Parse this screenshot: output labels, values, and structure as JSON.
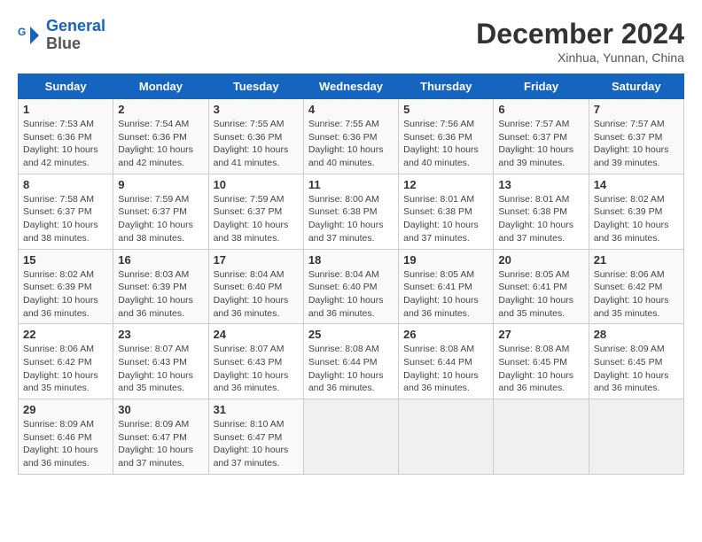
{
  "header": {
    "logo_line1": "General",
    "logo_line2": "Blue",
    "month": "December 2024",
    "location": "Xinhua, Yunnan, China"
  },
  "days_of_week": [
    "Sunday",
    "Monday",
    "Tuesday",
    "Wednesday",
    "Thursday",
    "Friday",
    "Saturday"
  ],
  "weeks": [
    [
      {
        "day": "1",
        "detail": "Sunrise: 7:53 AM\nSunset: 6:36 PM\nDaylight: 10 hours\nand 42 minutes."
      },
      {
        "day": "2",
        "detail": "Sunrise: 7:54 AM\nSunset: 6:36 PM\nDaylight: 10 hours\nand 42 minutes."
      },
      {
        "day": "3",
        "detail": "Sunrise: 7:55 AM\nSunset: 6:36 PM\nDaylight: 10 hours\nand 41 minutes."
      },
      {
        "day": "4",
        "detail": "Sunrise: 7:55 AM\nSunset: 6:36 PM\nDaylight: 10 hours\nand 40 minutes."
      },
      {
        "day": "5",
        "detail": "Sunrise: 7:56 AM\nSunset: 6:36 PM\nDaylight: 10 hours\nand 40 minutes."
      },
      {
        "day": "6",
        "detail": "Sunrise: 7:57 AM\nSunset: 6:37 PM\nDaylight: 10 hours\nand 39 minutes."
      },
      {
        "day": "7",
        "detail": "Sunrise: 7:57 AM\nSunset: 6:37 PM\nDaylight: 10 hours\nand 39 minutes."
      }
    ],
    [
      {
        "day": "8",
        "detail": "Sunrise: 7:58 AM\nSunset: 6:37 PM\nDaylight: 10 hours\nand 38 minutes."
      },
      {
        "day": "9",
        "detail": "Sunrise: 7:59 AM\nSunset: 6:37 PM\nDaylight: 10 hours\nand 38 minutes."
      },
      {
        "day": "10",
        "detail": "Sunrise: 7:59 AM\nSunset: 6:37 PM\nDaylight: 10 hours\nand 38 minutes."
      },
      {
        "day": "11",
        "detail": "Sunrise: 8:00 AM\nSunset: 6:38 PM\nDaylight: 10 hours\nand 37 minutes."
      },
      {
        "day": "12",
        "detail": "Sunrise: 8:01 AM\nSunset: 6:38 PM\nDaylight: 10 hours\nand 37 minutes."
      },
      {
        "day": "13",
        "detail": "Sunrise: 8:01 AM\nSunset: 6:38 PM\nDaylight: 10 hours\nand 37 minutes."
      },
      {
        "day": "14",
        "detail": "Sunrise: 8:02 AM\nSunset: 6:39 PM\nDaylight: 10 hours\nand 36 minutes."
      }
    ],
    [
      {
        "day": "15",
        "detail": "Sunrise: 8:02 AM\nSunset: 6:39 PM\nDaylight: 10 hours\nand 36 minutes."
      },
      {
        "day": "16",
        "detail": "Sunrise: 8:03 AM\nSunset: 6:39 PM\nDaylight: 10 hours\nand 36 minutes."
      },
      {
        "day": "17",
        "detail": "Sunrise: 8:04 AM\nSunset: 6:40 PM\nDaylight: 10 hours\nand 36 minutes."
      },
      {
        "day": "18",
        "detail": "Sunrise: 8:04 AM\nSunset: 6:40 PM\nDaylight: 10 hours\nand 36 minutes."
      },
      {
        "day": "19",
        "detail": "Sunrise: 8:05 AM\nSunset: 6:41 PM\nDaylight: 10 hours\nand 36 minutes."
      },
      {
        "day": "20",
        "detail": "Sunrise: 8:05 AM\nSunset: 6:41 PM\nDaylight: 10 hours\nand 35 minutes."
      },
      {
        "day": "21",
        "detail": "Sunrise: 8:06 AM\nSunset: 6:42 PM\nDaylight: 10 hours\nand 35 minutes."
      }
    ],
    [
      {
        "day": "22",
        "detail": "Sunrise: 8:06 AM\nSunset: 6:42 PM\nDaylight: 10 hours\nand 35 minutes."
      },
      {
        "day": "23",
        "detail": "Sunrise: 8:07 AM\nSunset: 6:43 PM\nDaylight: 10 hours\nand 35 minutes."
      },
      {
        "day": "24",
        "detail": "Sunrise: 8:07 AM\nSunset: 6:43 PM\nDaylight: 10 hours\nand 36 minutes."
      },
      {
        "day": "25",
        "detail": "Sunrise: 8:08 AM\nSunset: 6:44 PM\nDaylight: 10 hours\nand 36 minutes."
      },
      {
        "day": "26",
        "detail": "Sunrise: 8:08 AM\nSunset: 6:44 PM\nDaylight: 10 hours\nand 36 minutes."
      },
      {
        "day": "27",
        "detail": "Sunrise: 8:08 AM\nSunset: 6:45 PM\nDaylight: 10 hours\nand 36 minutes."
      },
      {
        "day": "28",
        "detail": "Sunrise: 8:09 AM\nSunset: 6:45 PM\nDaylight: 10 hours\nand 36 minutes."
      }
    ],
    [
      {
        "day": "29",
        "detail": "Sunrise: 8:09 AM\nSunset: 6:46 PM\nDaylight: 10 hours\nand 36 minutes."
      },
      {
        "day": "30",
        "detail": "Sunrise: 8:09 AM\nSunset: 6:47 PM\nDaylight: 10 hours\nand 37 minutes."
      },
      {
        "day": "31",
        "detail": "Sunrise: 8:10 AM\nSunset: 6:47 PM\nDaylight: 10 hours\nand 37 minutes."
      },
      {
        "day": "",
        "detail": ""
      },
      {
        "day": "",
        "detail": ""
      },
      {
        "day": "",
        "detail": ""
      },
      {
        "day": "",
        "detail": ""
      }
    ]
  ]
}
